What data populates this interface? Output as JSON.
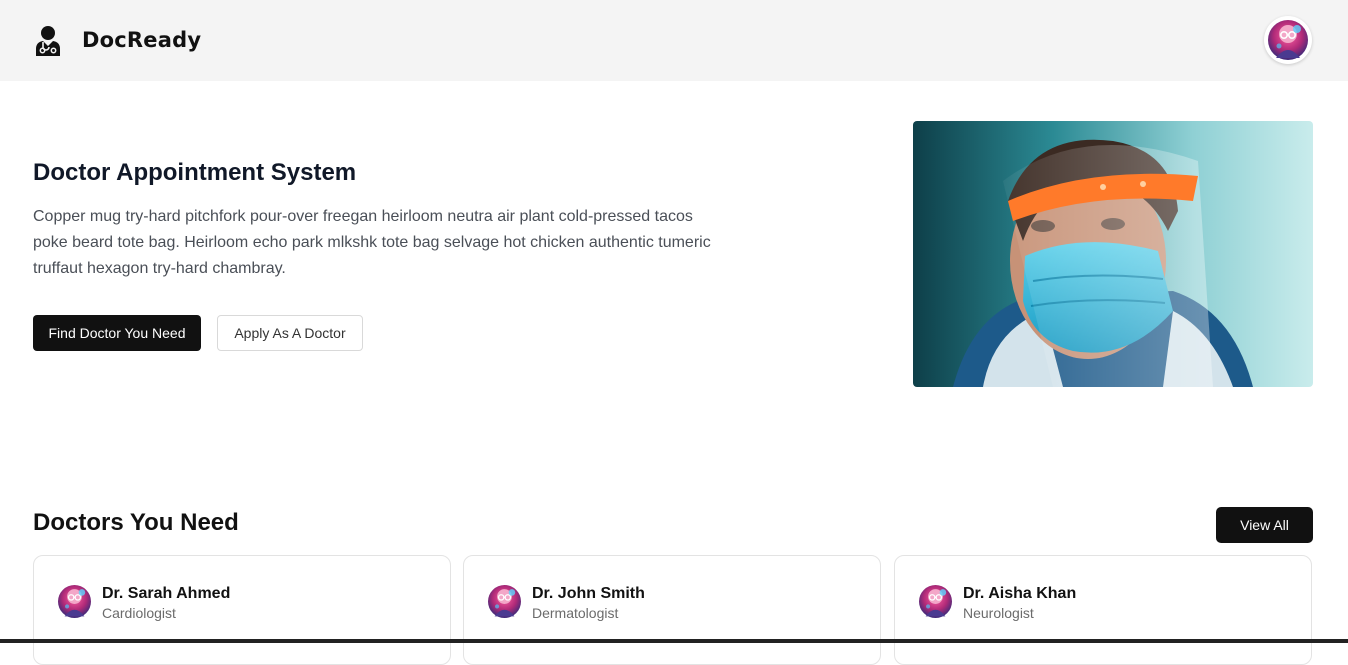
{
  "header": {
    "brand": "DocReady",
    "logo_icon": "doctor-icon",
    "avatar_icon": "user-avatar"
  },
  "hero": {
    "title": "Doctor Appointment System",
    "description": "Copper mug try-hard pitchfork pour-over freegan heirloom neutra air plant cold-pressed tacos poke beard tote bag. Heirloom echo park mlkshk tote bag selvage hot chicken authentic tumeric truffaut hexagon try-hard chambray.",
    "primary_button": "Find Doctor You Need",
    "secondary_button": "Apply As A Doctor"
  },
  "doctors_section": {
    "title": "Doctors You Need",
    "view_all": "View All",
    "doctors": [
      {
        "name": "Dr. Sarah Ahmed",
        "specialty": "Cardiologist"
      },
      {
        "name": "Dr. John Smith",
        "specialty": "Dermatologist"
      },
      {
        "name": "Dr. Aisha Khan",
        "specialty": "Neurologist"
      }
    ]
  },
  "colors": {
    "header_bg": "#f4f4f4",
    "primary_button_bg": "#111111",
    "text_dark": "#101828",
    "text_muted": "#4a4f57"
  }
}
